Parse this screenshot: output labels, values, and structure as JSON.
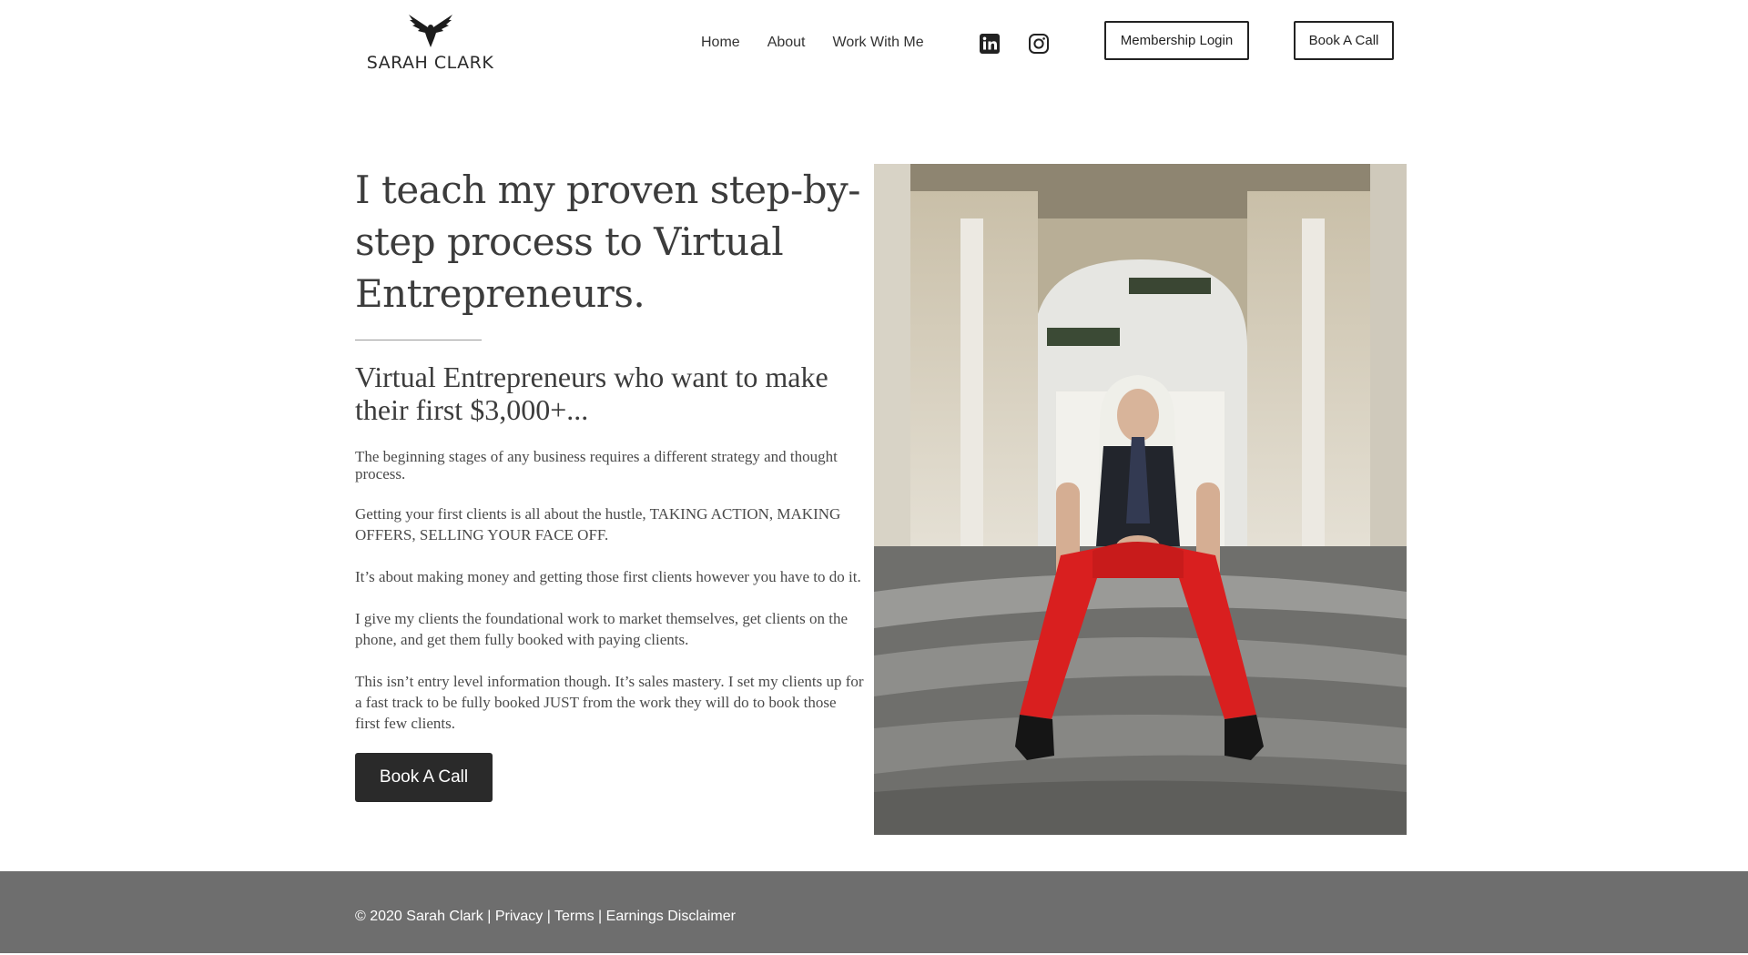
{
  "header": {
    "logo_text": "SARAH CLARK",
    "nav": [
      "Home",
      "About",
      "Work With Me"
    ],
    "social": [
      "linkedin-icon",
      "instagram-icon"
    ],
    "membership_label": "Membership Login",
    "book_label": "Book A Call"
  },
  "main": {
    "headline": "I teach my proven step-by-step process to Virtual Entrepreneurs.",
    "subhead": "Virtual Entrepreneurs who want to make their first $3,000+...",
    "paragraphs": [
      "The beginning stages of any business requires a different strategy and thought process.",
      "Getting your first clients is all about the hustle,  TAKING ACTION, MAKING OFFERS, SELLING YOUR FACE OFF.",
      "It’s about making money and getting those first clients however you have to do it.",
      "I give my clients the foundational work to market themselves, get clients on the phone, and get them fully booked with paying clients.",
      "This isn’t entry level information though. It’s sales mastery. I set my clients up for a fast track to be fully booked JUST from the work they will do to book those first few clients."
    ],
    "cta_label": "Book A Call"
  },
  "footer": {
    "copyright": "© 2020 Sarah Clark |",
    "privacy": "Privacy",
    "sep1": " |",
    "terms": "Terms",
    "sep2": "|",
    "disclaimer": "Earnings Disclaimer"
  },
  "colors": {
    "footer_bg": "#6e6e6e",
    "cta_bg": "#2a2a2a",
    "pants": "#d91f1f"
  }
}
